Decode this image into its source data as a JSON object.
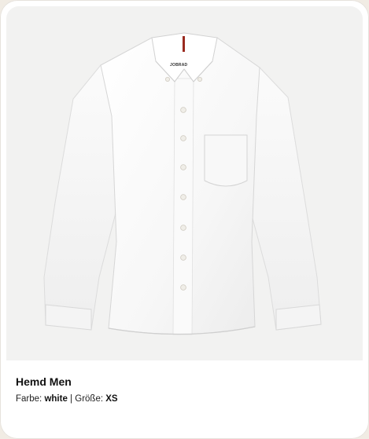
{
  "product": {
    "name": "Hemd Men",
    "color_label": "Farbe:",
    "color_value": "white",
    "separator": "|",
    "size_label": "Größe:",
    "size_value": "XS",
    "brand_tag": "JOBRAD",
    "image_icon": "shirt-image"
  },
  "colors": {
    "page_background": "#f1ece4",
    "card_background": "#ffffff",
    "image_background": "#f2f2f1",
    "text_primary": "#111111"
  }
}
